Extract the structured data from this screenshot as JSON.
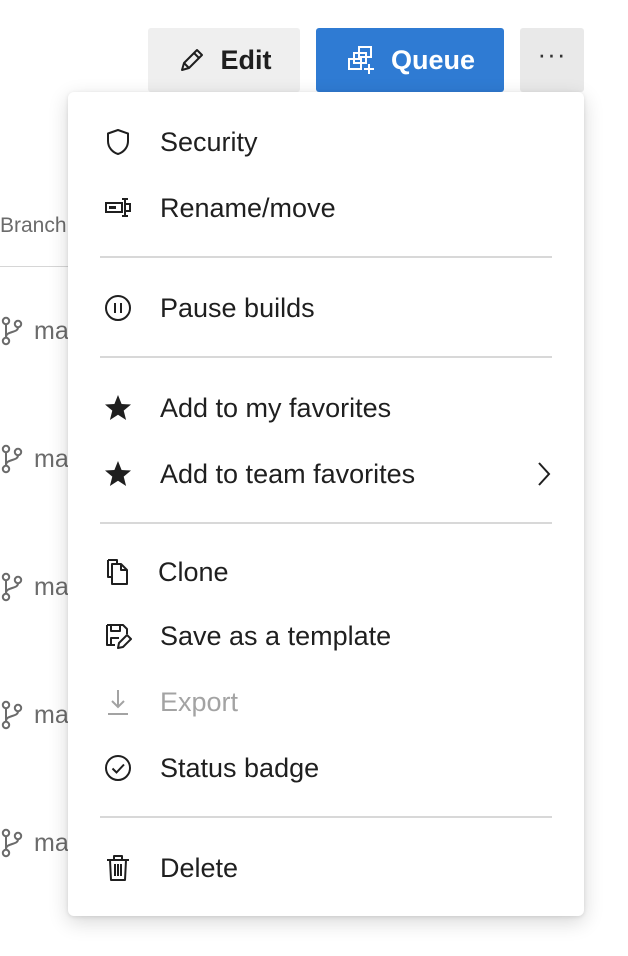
{
  "background": {
    "column_header": "Branch",
    "branch_rows": [
      {
        "label": "main"
      },
      {
        "label": "main"
      },
      {
        "label": "main"
      },
      {
        "label": "main"
      },
      {
        "label": "main"
      }
    ]
  },
  "toolbar": {
    "edit_label": "Edit",
    "queue_label": "Queue",
    "more_label": "···",
    "accent_color": "#2f7bd3"
  },
  "menu": {
    "items": [
      {
        "label": "Security",
        "icon": "shield-icon",
        "enabled": true
      },
      {
        "label": "Rename/move",
        "icon": "rename-icon",
        "enabled": true
      },
      {
        "label": "Pause builds",
        "icon": "pause-icon",
        "enabled": true
      },
      {
        "label": "Add to my favorites",
        "icon": "star-icon",
        "enabled": true
      },
      {
        "label": "Add to team favorites",
        "icon": "star-icon",
        "enabled": true,
        "has_submenu": true
      },
      {
        "label": "Clone",
        "icon": "clone-icon",
        "enabled": true
      },
      {
        "label": "Save as a template",
        "icon": "save-template-icon",
        "enabled": true
      },
      {
        "label": "Export",
        "icon": "export-icon",
        "enabled": false
      },
      {
        "label": "Status badge",
        "icon": "status-badge-icon",
        "enabled": true
      },
      {
        "label": "Delete",
        "icon": "trash-icon",
        "enabled": true
      }
    ]
  }
}
